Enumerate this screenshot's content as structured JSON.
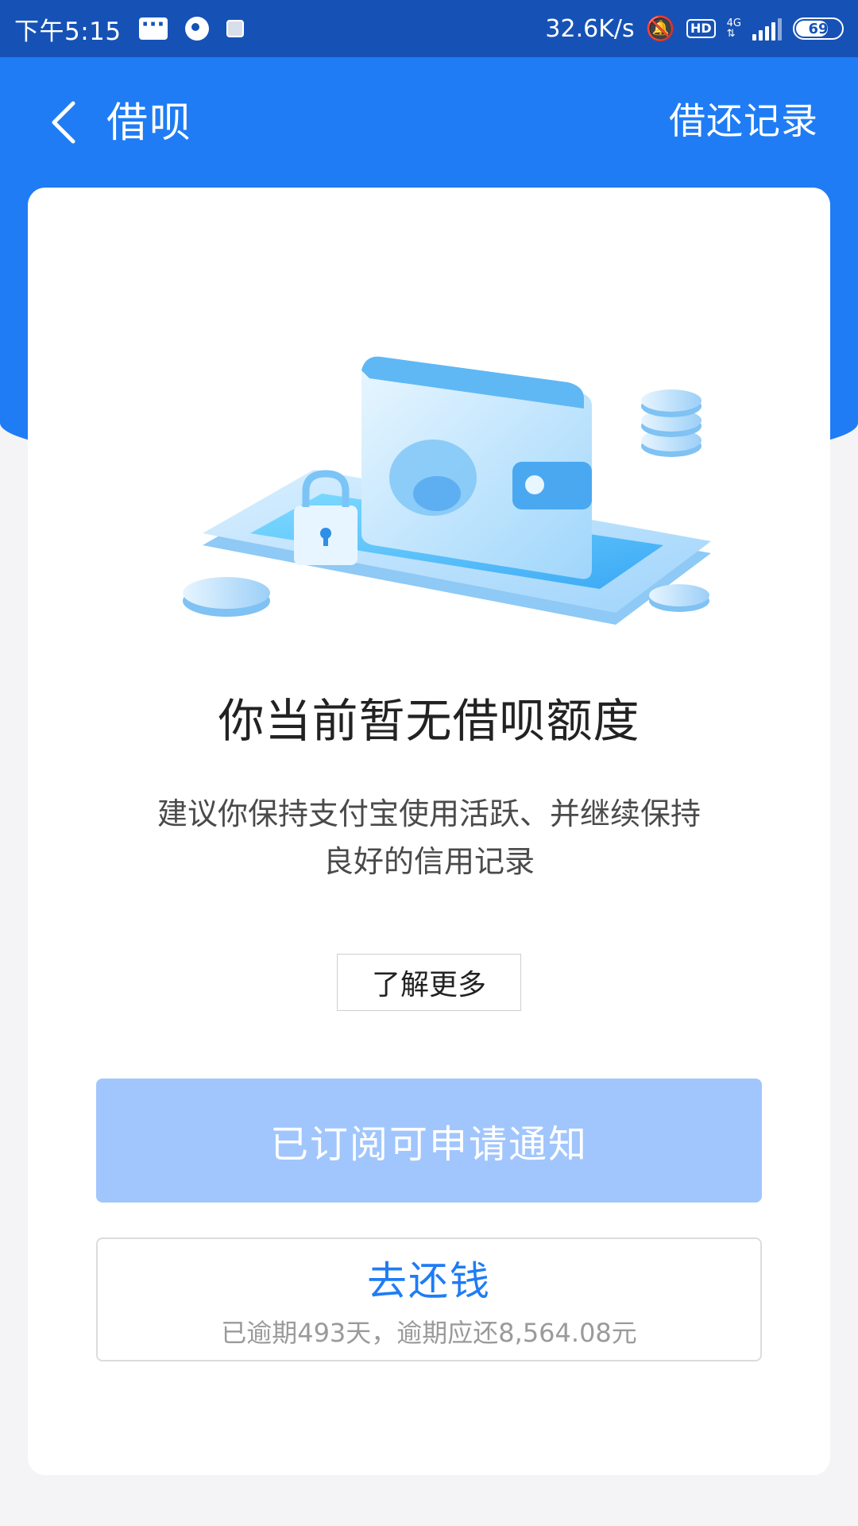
{
  "status_bar": {
    "time": "下午5:15",
    "network_speed": "32.6K/s",
    "hd": "HD",
    "network_type": "4G",
    "battery": "69"
  },
  "nav": {
    "title": "借呗",
    "right_link": "借还记录"
  },
  "main": {
    "headline": "你当前暂无借呗额度",
    "description_line1": "建议你保持支付宝使用活跃、并继续保持",
    "description_line2": "良好的信用记录",
    "learn_more": "了解更多",
    "subscribe_button": "已订阅可申请通知",
    "repay_button": "去还钱",
    "repay_detail": "已逾期493天，逾期应还8,564.08元"
  },
  "colors": {
    "status_bar": "#1652b6",
    "header": "#1f7cf5",
    "subscribe_button": "#a1c6fd",
    "repay_text": "#1f7cf5"
  },
  "icons": [
    "message-icon",
    "circle-app-icon",
    "card-app-icon",
    "bell-muted-icon",
    "hd-icon",
    "signal-icon",
    "battery-icon",
    "back-chevron-icon",
    "wallet-illustration"
  ]
}
